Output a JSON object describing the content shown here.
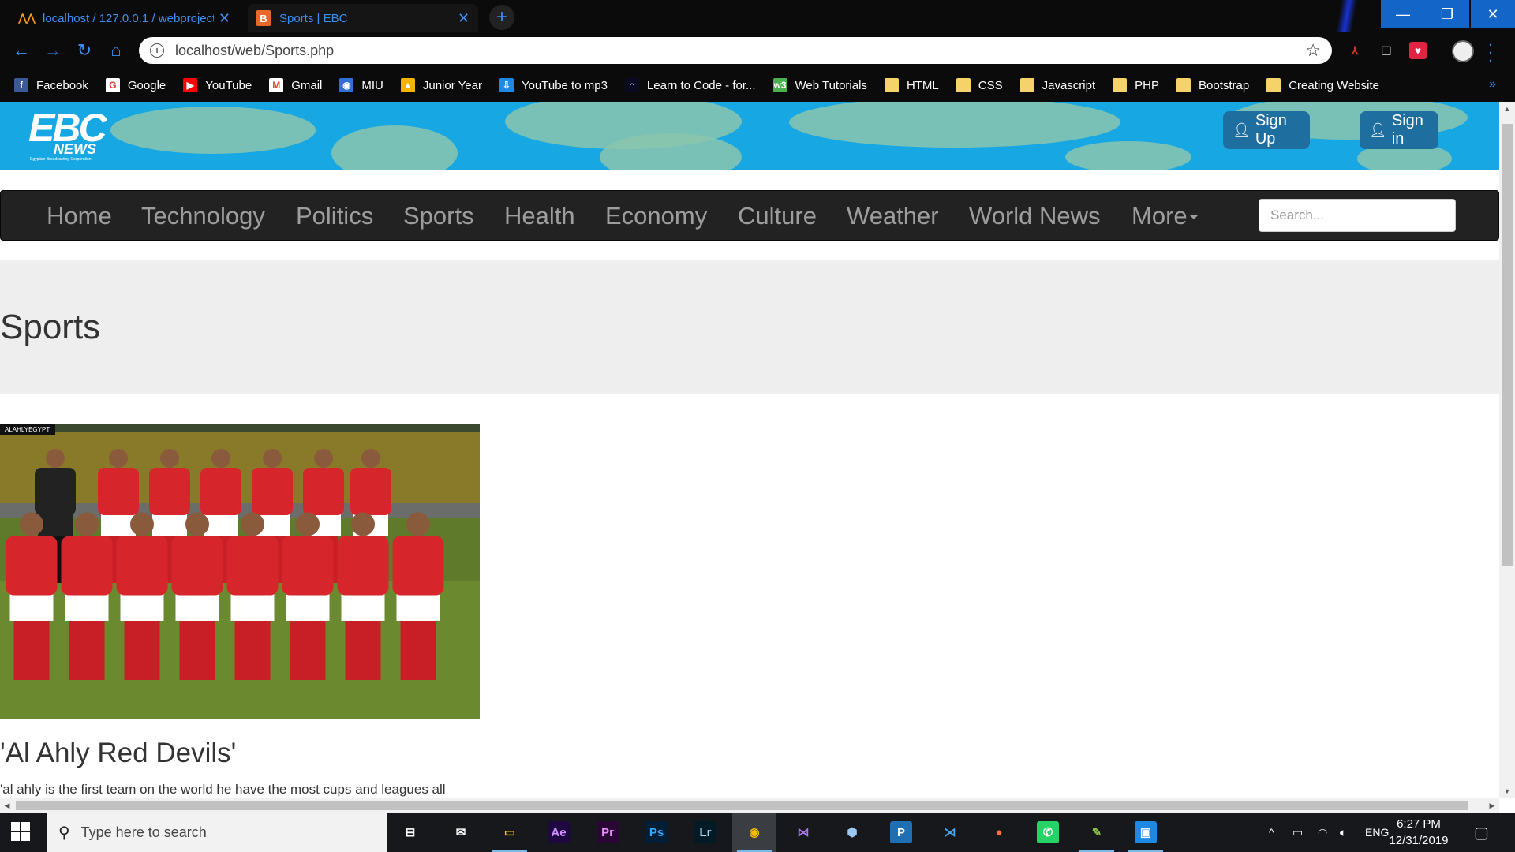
{
  "browser": {
    "tabs": [
      {
        "label": "localhost / 127.0.0.1 / webproject",
        "active": false
      },
      {
        "label": "Sports | EBC",
        "active": true
      }
    ],
    "new_tab_label": "+",
    "url": "localhost/web/Sports.php",
    "bookmarks": [
      {
        "label": "Facebook",
        "icon": "facebook-icon",
        "color": "#3b5998",
        "glyph": "f"
      },
      {
        "label": "Google",
        "icon": "google-icon",
        "color": "#ffffff",
        "glyph": "G"
      },
      {
        "label": "YouTube",
        "icon": "youtube-icon",
        "color": "#ff0000",
        "glyph": "▶"
      },
      {
        "label": "Gmail",
        "icon": "gmail-icon",
        "color": "#ffffff",
        "glyph": "M"
      },
      {
        "label": "MIU",
        "icon": "globe-icon",
        "color": "#2f6fd6",
        "glyph": "◉"
      },
      {
        "label": "Junior Year",
        "icon": "drive-icon",
        "color": "#f4b400",
        "glyph": "▲"
      },
      {
        "label": "YouTube to mp3",
        "icon": "download-icon",
        "color": "#1e88e5",
        "glyph": "⇩"
      },
      {
        "label": "Learn to Code - for...",
        "icon": "code-icon",
        "color": "#0a0a23",
        "glyph": "⌂"
      },
      {
        "label": "Web Tutorials",
        "icon": "w3-icon",
        "color": "#4caf50",
        "glyph": "w3"
      },
      {
        "label": "HTML",
        "icon": "folder-icon",
        "color": "#f6d26b",
        "glyph": ""
      },
      {
        "label": "CSS",
        "icon": "folder-icon",
        "color": "#f6d26b",
        "glyph": ""
      },
      {
        "label": "Javascript",
        "icon": "folder-icon",
        "color": "#f6d26b",
        "glyph": ""
      },
      {
        "label": "PHP",
        "icon": "folder-icon",
        "color": "#f6d26b",
        "glyph": ""
      },
      {
        "label": "Bootstrap",
        "icon": "folder-icon",
        "color": "#f6d26b",
        "glyph": ""
      },
      {
        "label": "Creating Website",
        "icon": "folder-icon",
        "color": "#f6d26b",
        "glyph": ""
      }
    ],
    "bookmarks_more": "»"
  },
  "site": {
    "logo": {
      "main": "EBC",
      "sub": "NEWS",
      "tagline": "Egyptian Broadcasting Corporation"
    },
    "signup_label": "Sign Up",
    "signin_label": "Sign in",
    "nav": [
      "Home",
      "Technology",
      "Politics",
      "Sports",
      "Health",
      "Economy",
      "Culture",
      "Weather",
      "World News",
      "More"
    ],
    "search_placeholder": "Search...",
    "page_title": "Sports",
    "article": {
      "image_watermark": "ALAHLYEGYPT",
      "title": "'Al Ahly Red Devils'",
      "text": "'al ahly is the first team on the world he have the most cups and leagues all"
    }
  },
  "taskbar": {
    "search_placeholder": "Type here to search",
    "apps": [
      {
        "name": "task-view",
        "glyph": "⊟",
        "color": "#ffffff",
        "bg": "transparent"
      },
      {
        "name": "mail",
        "glyph": "✉",
        "color": "#ffffff",
        "bg": "transparent"
      },
      {
        "name": "file-explorer",
        "glyph": "▭",
        "color": "#f0c419",
        "bg": "transparent"
      },
      {
        "name": "after-effects",
        "glyph": "Ae",
        "color": "#d291ff",
        "bg": "#1f0740"
      },
      {
        "name": "premiere",
        "glyph": "Pr",
        "color": "#e98cff",
        "bg": "#2a0634"
      },
      {
        "name": "photoshop",
        "glyph": "Ps",
        "color": "#31a8ff",
        "bg": "#001e36"
      },
      {
        "name": "lightroom",
        "glyph": "Lr",
        "color": "#add5ec",
        "bg": "#001a26"
      },
      {
        "name": "chrome",
        "glyph": "◉",
        "color": "#fbbc05",
        "bg": "transparent"
      },
      {
        "name": "visual-studio",
        "glyph": "⋈",
        "color": "#a876e8",
        "bg": "transparent"
      },
      {
        "name": "cube-app",
        "glyph": "⬢",
        "color": "#9ec7f2",
        "bg": "transparent"
      },
      {
        "name": "publisher",
        "glyph": "P",
        "color": "#ffffff",
        "bg": "#1f6fb5"
      },
      {
        "name": "vscode",
        "glyph": "⋊",
        "color": "#3fa7f5",
        "bg": "transparent"
      },
      {
        "name": "firefox",
        "glyph": "●",
        "color": "#ff7139",
        "bg": "transparent"
      },
      {
        "name": "whatsapp",
        "glyph": "✆",
        "color": "#ffffff",
        "bg": "#25d366"
      },
      {
        "name": "notepad-plus",
        "glyph": "✎",
        "color": "#8bc34a",
        "bg": "transparent"
      },
      {
        "name": "photos",
        "glyph": "▣",
        "color": "#ffffff",
        "bg": "#1e88e5"
      }
    ],
    "language": "ENG",
    "time": "6:27 PM",
    "date": "12/31/2019"
  }
}
